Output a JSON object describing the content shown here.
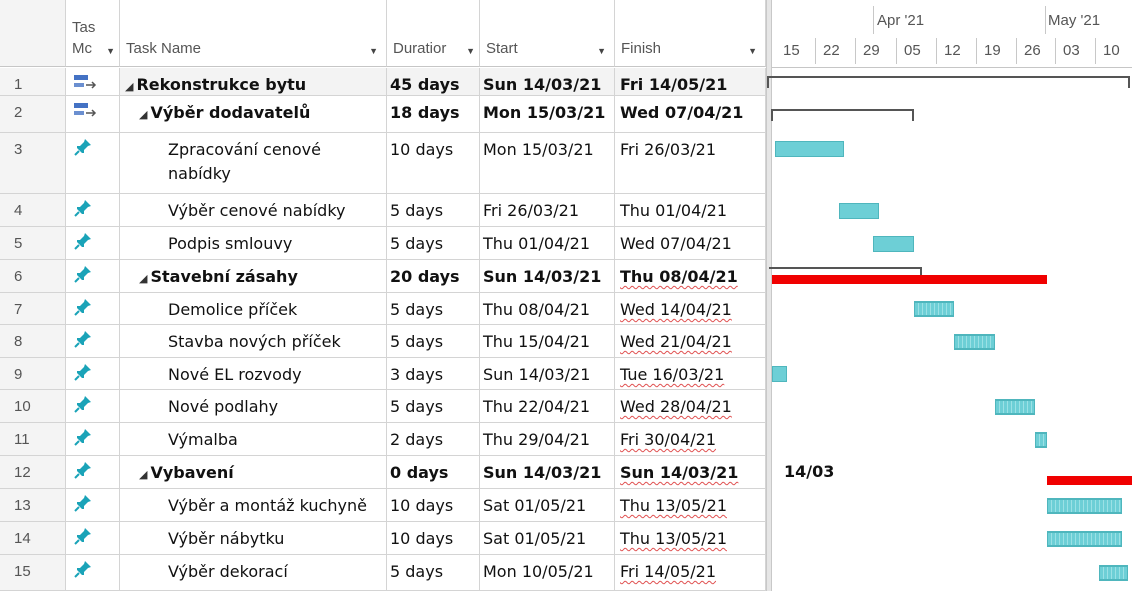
{
  "columns": {
    "num": "",
    "mode_line1": "Tas",
    "mode_line2": "Mc",
    "name": "Task Name",
    "duration": "Duratior",
    "start": "Start",
    "finish": "Finish"
  },
  "timeline": {
    "months": [
      "Apr '21",
      "May '21"
    ],
    "weeks": [
      "15",
      "22",
      "29",
      "05",
      "12",
      "19",
      "26",
      "03",
      "10"
    ],
    "milestone_label": "14/03"
  },
  "colors": {
    "task_bar": "#6dcfd6",
    "critical_bar": "#f00000",
    "summary_bar": "#555555",
    "auto_icon": "#4472c4",
    "pin_icon": "#1aa3b8"
  },
  "tasks": [
    {
      "id": "1",
      "mode": "auto",
      "name": "Rekonstrukce bytu",
      "duration": "45 days",
      "start": "Sun 14/03/21",
      "finish": "Fri 14/05/21",
      "bold": true,
      "indent": 0,
      "summary": true
    },
    {
      "id": "2",
      "mode": "auto",
      "name": "Výběr dodavatelů",
      "duration": "18 days",
      "start": "Mon 15/03/21",
      "finish": "Wed 07/04/21",
      "bold": true,
      "indent": 1,
      "summary": true
    },
    {
      "id": "3",
      "mode": "manual",
      "name": "Zpracování cenové nabídky",
      "duration": "10 days",
      "start": "Mon 15/03/21",
      "finish": "Fri 26/03/21",
      "bold": false,
      "indent": 2,
      "summary": false
    },
    {
      "id": "4",
      "mode": "manual",
      "name": "Výběr cenové nabídky",
      "duration": "5 days",
      "start": "Fri 26/03/21",
      "finish": "Thu 01/04/21",
      "bold": false,
      "indent": 2,
      "summary": false
    },
    {
      "id": "5",
      "mode": "manual",
      "name": "Podpis smlouvy",
      "duration": "5 days",
      "start": "Thu 01/04/21",
      "finish": "Wed 07/04/21",
      "bold": false,
      "indent": 2,
      "summary": false
    },
    {
      "id": "6",
      "mode": "manual",
      "name": "Stavební zásahy",
      "duration": "20 days",
      "start": "Sun 14/03/21",
      "finish": "Thu 08/04/21",
      "bold": true,
      "indent": 1,
      "summary": true
    },
    {
      "id": "7",
      "mode": "manual",
      "name": "Demolice příček",
      "duration": "5 days",
      "start": "Thu 08/04/21",
      "finish": "Wed 14/04/21",
      "bold": false,
      "indent": 2,
      "summary": false
    },
    {
      "id": "8",
      "mode": "manual",
      "name": "Stavba nových příček",
      "duration": "5 days",
      "start": "Thu 15/04/21",
      "finish": "Wed 21/04/21",
      "bold": false,
      "indent": 2,
      "summary": false
    },
    {
      "id": "9",
      "mode": "manual",
      "name": "Nové EL rozvody",
      "duration": "3 days",
      "start": "Sun 14/03/21",
      "finish": "Tue 16/03/21",
      "bold": false,
      "indent": 2,
      "summary": false
    },
    {
      "id": "10",
      "mode": "manual",
      "name": "Nové podlahy",
      "duration": "5 days",
      "start": "Thu 22/04/21",
      "finish": "Wed 28/04/21",
      "bold": false,
      "indent": 2,
      "summary": false
    },
    {
      "id": "11",
      "mode": "manual",
      "name": "Výmalba",
      "duration": "2 days",
      "start": "Thu 29/04/21",
      "finish": "Fri 30/04/21",
      "bold": false,
      "indent": 2,
      "summary": false
    },
    {
      "id": "12",
      "mode": "manual",
      "name": "Vybavení",
      "duration": "0 days",
      "start": "Sun 14/03/21",
      "finish": "Sun 14/03/21",
      "bold": true,
      "indent": 1,
      "summary": true
    },
    {
      "id": "13",
      "mode": "manual",
      "name": "Výběr a montáž kuchyně",
      "duration": "10 days",
      "start": "Sat 01/05/21",
      "finish": "Thu 13/05/21",
      "bold": false,
      "indent": 2,
      "summary": false
    },
    {
      "id": "14",
      "mode": "manual",
      "name": "Výběr nábytku",
      "duration": "10 days",
      "start": "Sat 01/05/21",
      "finish": "Thu 13/05/21",
      "bold": false,
      "indent": 2,
      "summary": false
    },
    {
      "id": "15",
      "mode": "manual",
      "name": "Výběr dekorací",
      "duration": "5 days",
      "start": "Mon 10/05/21",
      "finish": "Fri 14/05/21",
      "bold": false,
      "indent": 2,
      "summary": false
    }
  ]
}
